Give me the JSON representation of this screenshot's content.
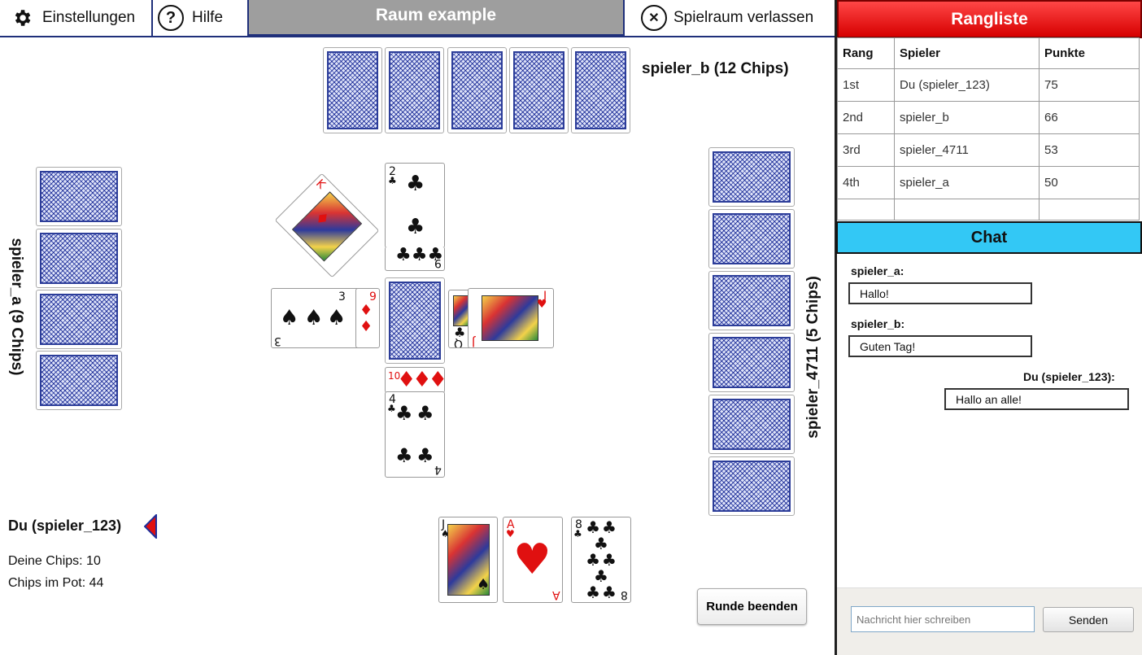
{
  "topbar": {
    "settings_label": "Einstellungen",
    "help_label": "Hilfe",
    "room_title": "Raum example",
    "leave_label": "Spielraum verlassen"
  },
  "opponents": {
    "top": "spieler_b (12 Chips)",
    "left": "spieler_a (9 Chips)",
    "right": "spieler_4711 (5 Chips)"
  },
  "me": {
    "name": "Du (spieler_123)",
    "chips": "Deine Chips: 10",
    "pot": "Chips im Pot: 44"
  },
  "end_round_label": "Runde beenden",
  "leaderboard": {
    "title": "Rangliste",
    "columns": [
      "Rang",
      "Spieler",
      "Punkte"
    ],
    "rows": [
      [
        "1st",
        "Du (spieler_123)",
        "75"
      ],
      [
        "2nd",
        "spieler_b",
        "66"
      ],
      [
        "3rd",
        "spieler_4711",
        "53"
      ],
      [
        "4th",
        "spieler_a",
        "50"
      ]
    ]
  },
  "chat": {
    "title": "Chat",
    "messages": [
      {
        "author": "spieler_a:",
        "text": "Hallo!"
      },
      {
        "author": "spieler_b:",
        "text": "Guten Tag!"
      },
      {
        "author": "Du (spieler_123):",
        "text": "Hallo an alle!"
      }
    ],
    "input_placeholder": "Nachricht hier schreiben",
    "send_label": "Senden"
  },
  "cards": {
    "table": [
      "K♦",
      "2♣",
      "9♦",
      "3♠",
      "Q♣",
      "J♥",
      "10♦",
      "4♣"
    ],
    "hand": [
      "J♠",
      "A♥",
      "8♣"
    ],
    "rank_labels": {
      "k": "K",
      "two": "2",
      "three": "3",
      "nine": "9",
      "queen": "Q",
      "jack": "J",
      "ten": "10",
      "four": "4",
      "ace": "A",
      "eight": "8"
    }
  },
  "colors": {
    "accent_blue": "#1f2f7a",
    "leaderboard_red": "#e81b1b",
    "chat_cyan": "#33c8f5",
    "card_back_blue": "#3d4fb0",
    "suit_red": "#e01010"
  }
}
